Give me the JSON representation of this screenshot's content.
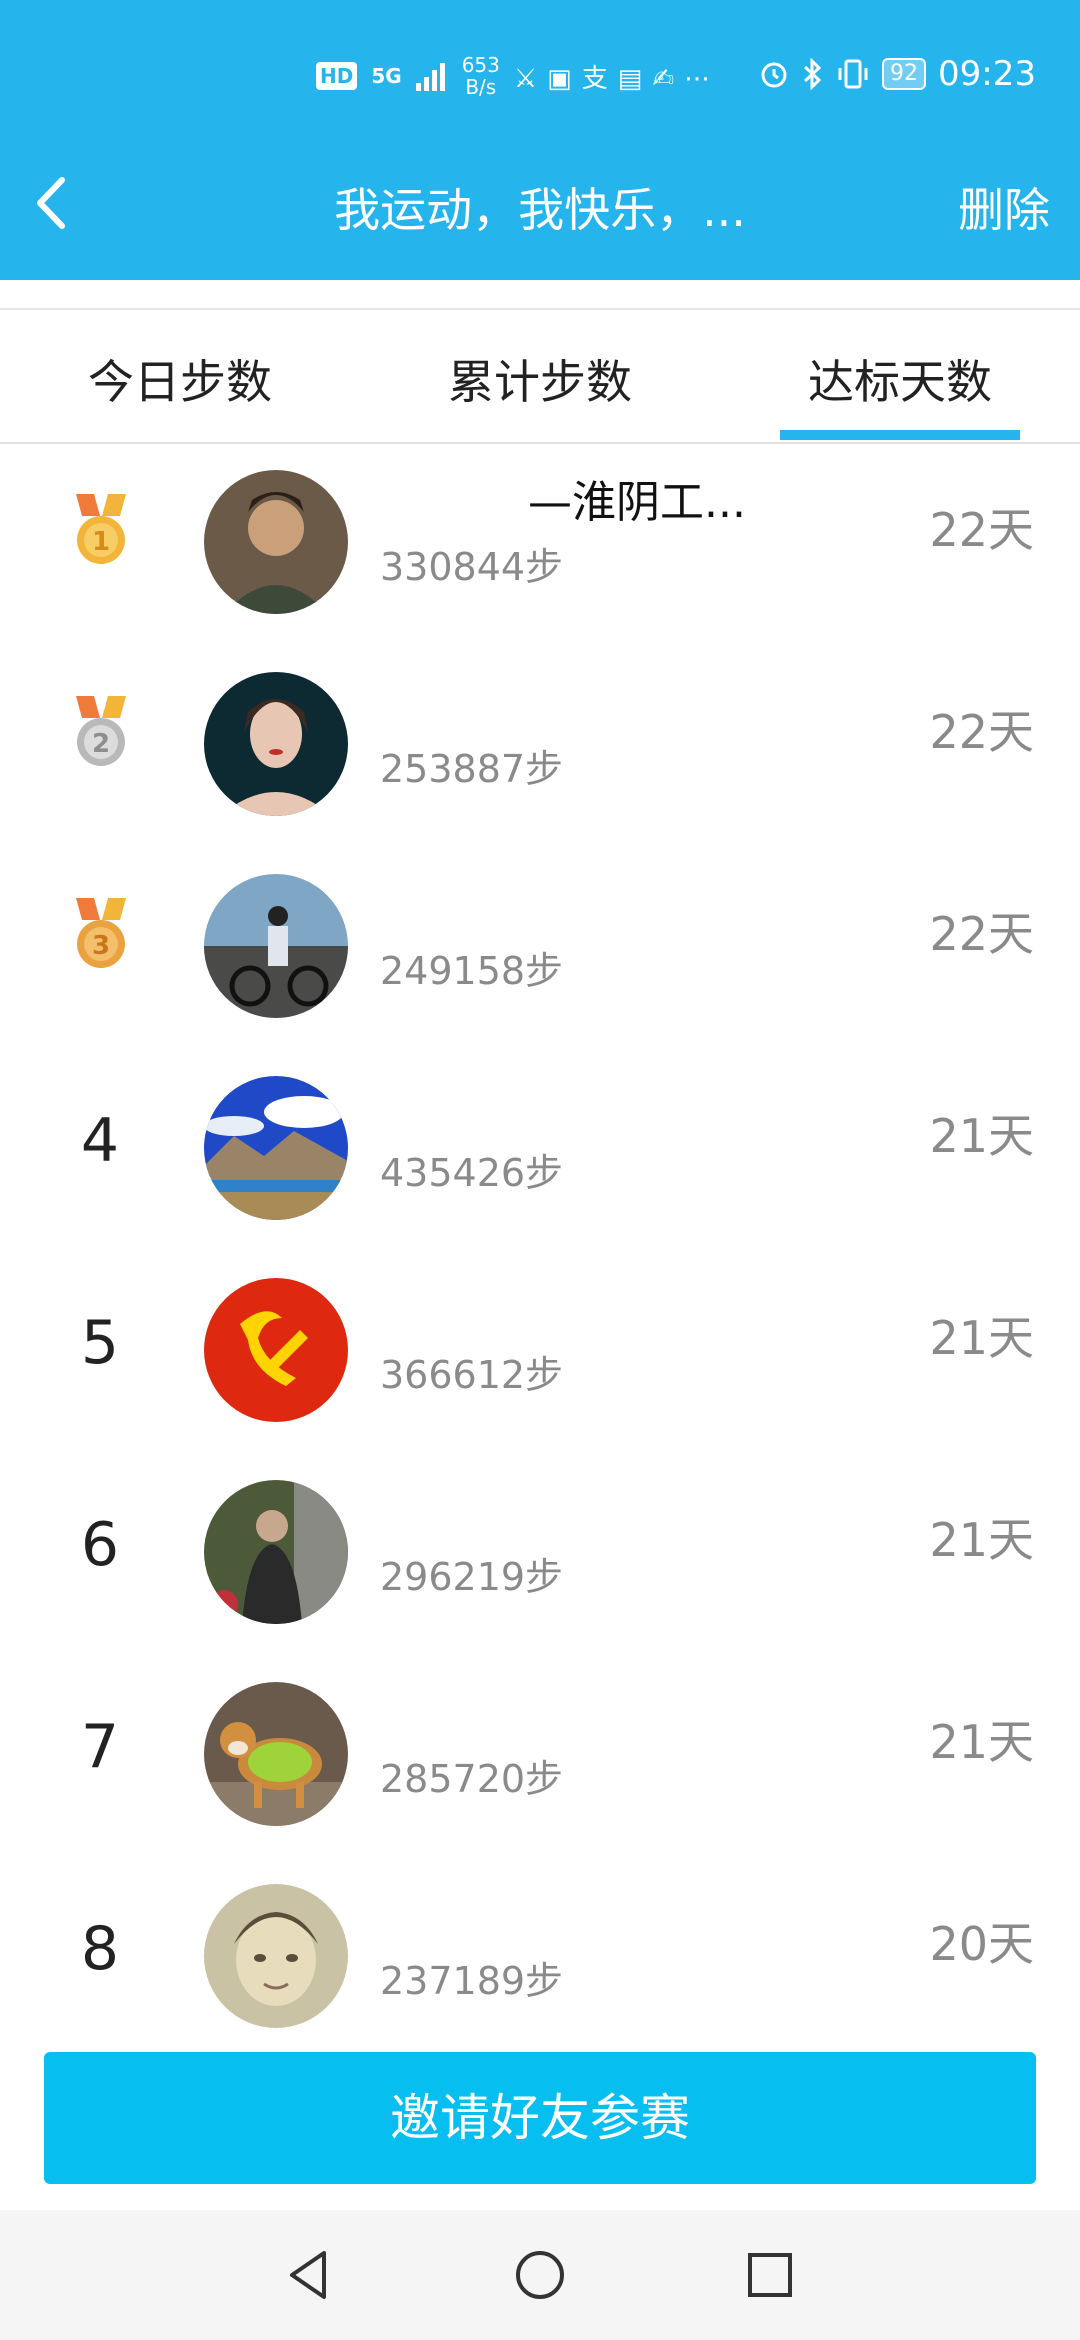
{
  "status_bar": {
    "hd": "HD",
    "net": "5G",
    "speed_value": "653",
    "speed_unit": "B/s",
    "battery": "92",
    "time": "09:23"
  },
  "header": {
    "title": "我运动，我快乐，...",
    "delete_label": "删除"
  },
  "tabs": [
    {
      "label": "今日步数"
    },
    {
      "label": "累计步数"
    },
    {
      "label": "达标天数",
      "active": true
    }
  ],
  "ranking": [
    {
      "rank": "1",
      "name": "—淮阴工...",
      "steps": "330844步",
      "days": "22天",
      "medal": "gold"
    },
    {
      "rank": "2",
      "name": "",
      "steps": "253887步",
      "days": "22天",
      "medal": "silver"
    },
    {
      "rank": "3",
      "name": "",
      "steps": "249158步",
      "days": "22天",
      "medal": "bronze"
    },
    {
      "rank": "4",
      "name": "",
      "steps": "435426步",
      "days": "21天"
    },
    {
      "rank": "5",
      "name": "",
      "steps": "366612步",
      "days": "21天"
    },
    {
      "rank": "6",
      "name": "",
      "steps": "296219步",
      "days": "21天"
    },
    {
      "rank": "7",
      "name": "",
      "steps": "285720步",
      "days": "21天"
    },
    {
      "rank": "8",
      "name": "",
      "steps": "237189步",
      "days": "20天"
    }
  ],
  "invite_button": "邀请好友参赛",
  "colors": {
    "accent": "#26b4ec",
    "button": "#06bff0",
    "gold": "#f2b53a",
    "silver": "#b9b9b9",
    "bronze": "#e9a23f"
  },
  "icons": {
    "back": "back-arrow-icon",
    "medal": "medal-icon",
    "nav_back": "nav-back-icon",
    "nav_home": "nav-home-icon",
    "nav_recents": "nav-recents-icon"
  }
}
